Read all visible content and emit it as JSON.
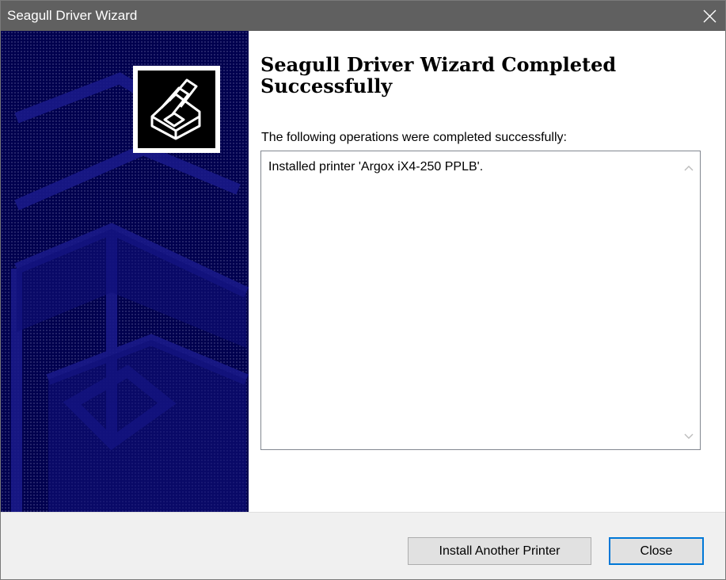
{
  "window": {
    "title": "Seagull Driver Wizard",
    "close_icon": "close-icon"
  },
  "main": {
    "heading": "Seagull Driver Wizard Completed Successfully",
    "lead": "The following operations were completed successfully:",
    "log_lines": [
      "Installed printer 'Argox iX4-250 PPLB'."
    ]
  },
  "buttons": {
    "install_another": "Install Another Printer",
    "close": "Close"
  },
  "colors": {
    "titlebar": "#606060",
    "side_panel": "#00004e",
    "focus_border": "#0078d7"
  }
}
